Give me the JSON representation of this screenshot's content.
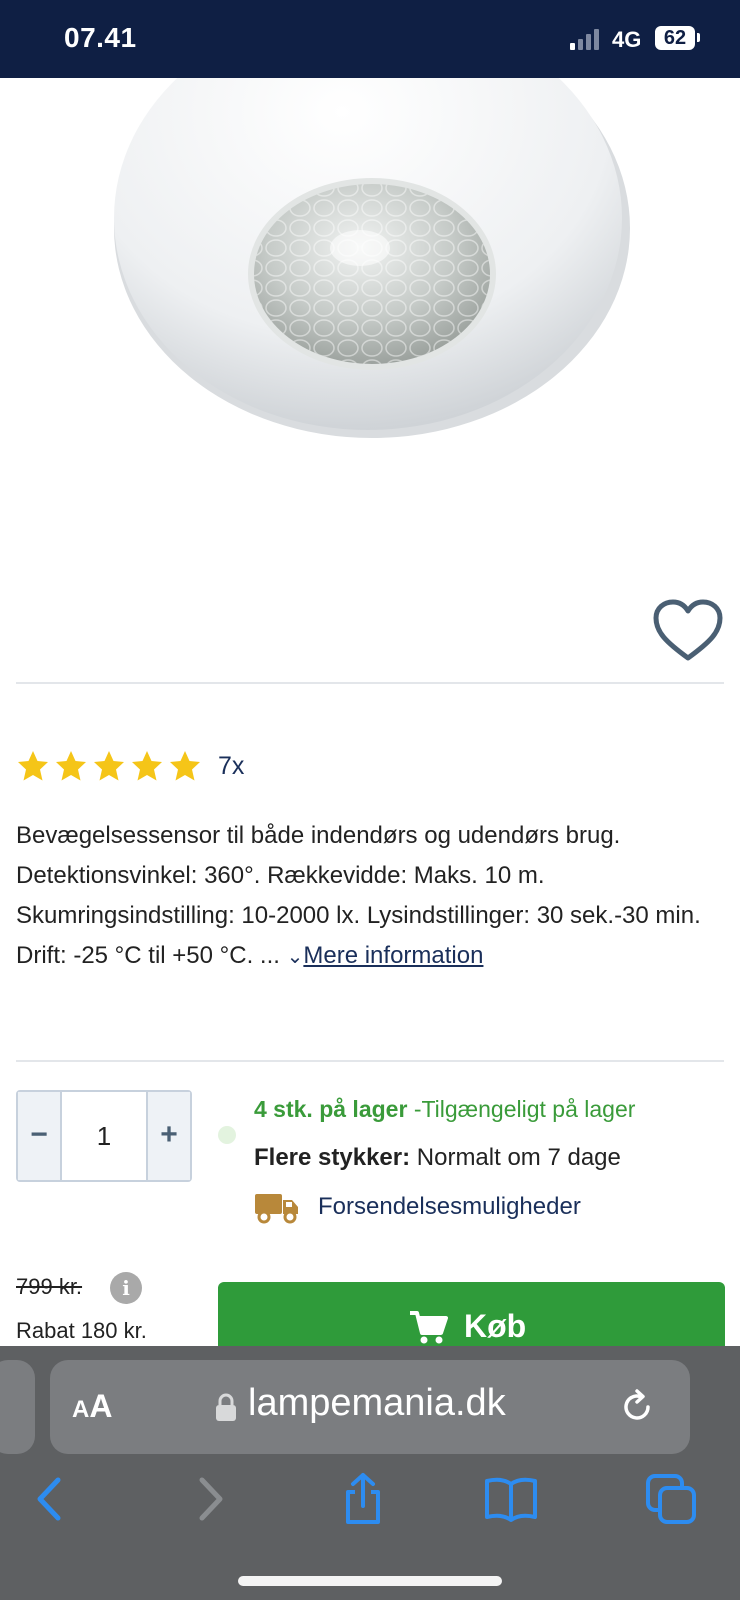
{
  "status_bar": {
    "time": "07.41",
    "network": "4G",
    "battery": "62"
  },
  "product": {
    "rating_count": "7x",
    "description": "Bevægelsessensor til både indendørs og udendørs brug. Detektionsvinkel: 360°. Rækkevidde: Maks. 10 m. Skumringsindstilling: 10-2000 lx. Lysindstillinger: 30 sek.-30 min. Drift: -25 °C til +50 °C. ... ",
    "more_label": "Mere information"
  },
  "rating": {
    "stars": 5,
    "max": 5
  },
  "quantity": {
    "minus": "−",
    "value": "1",
    "plus": "+"
  },
  "stock": {
    "count_label": "4 stk. på lager",
    "status": "-Tilgængeligt på lager",
    "more_units_label": "Flere stykker:",
    "more_units_value": "Normalt om 7 dage",
    "shipping_label": "Forsendelsesmuligheder"
  },
  "price": {
    "old_price": "799 kr.",
    "info": "i",
    "discount": "Rabat 180 kr.",
    "buy_label": "Køb"
  },
  "browser": {
    "aa_big": "A",
    "aa_small": "A",
    "domain": "lampemania.dk"
  },
  "colors": {
    "status_bar_bg": "#0f1f44",
    "buy_button": "#2f9b3a",
    "stock_green": "#3a9b3a",
    "star": "#f5c518",
    "link": "#1a2f5a",
    "safari_bar": "#5e6062",
    "safari_icon": "#2d8cf0"
  }
}
